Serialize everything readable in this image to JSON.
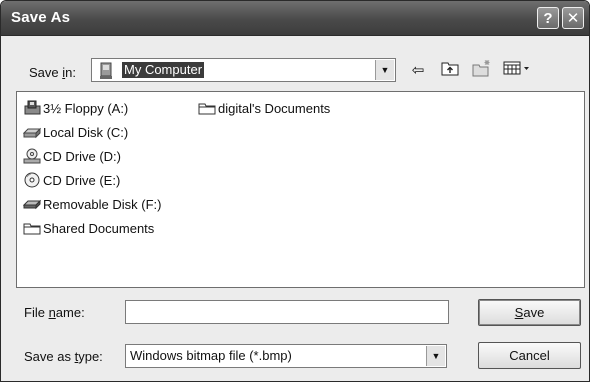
{
  "window": {
    "title": "Save As",
    "help_glyph": "?",
    "close_glyph": "✕"
  },
  "save_in": {
    "label_pre": "Save ",
    "label_accel": "i",
    "label_post": "n:",
    "value": "My Computer"
  },
  "toolbar": {
    "back_icon": "back-arrow-icon",
    "up_icon": "up-folder-icon",
    "new_folder_icon": "new-folder-icon",
    "views_icon": "views-menu-icon"
  },
  "items": [
    {
      "label": "3½ Floppy (A:)",
      "icon": "floppy-drive-icon"
    },
    {
      "label": "Local Disk (C:)",
      "icon": "hard-disk-icon"
    },
    {
      "label": "CD Drive (D:)",
      "icon": "cd-drive-icon"
    },
    {
      "label": "CD Drive (E:)",
      "icon": "cd-drive-icon"
    },
    {
      "label": "Removable Disk (F:)",
      "icon": "removable-disk-icon"
    },
    {
      "label": "Shared Documents",
      "icon": "folder-icon"
    },
    {
      "label": "digital's Documents",
      "icon": "folder-icon"
    }
  ],
  "file_name": {
    "label_pre": "File ",
    "label_accel": "n",
    "label_post": "ame:",
    "value": ""
  },
  "save_as_type": {
    "label_pre": "Save as ",
    "label_accel": "t",
    "label_post": "ype:",
    "value": "Windows bitmap file (*.bmp)"
  },
  "buttons": {
    "save_accel": "S",
    "save_post": "ave",
    "cancel": "Cancel"
  }
}
